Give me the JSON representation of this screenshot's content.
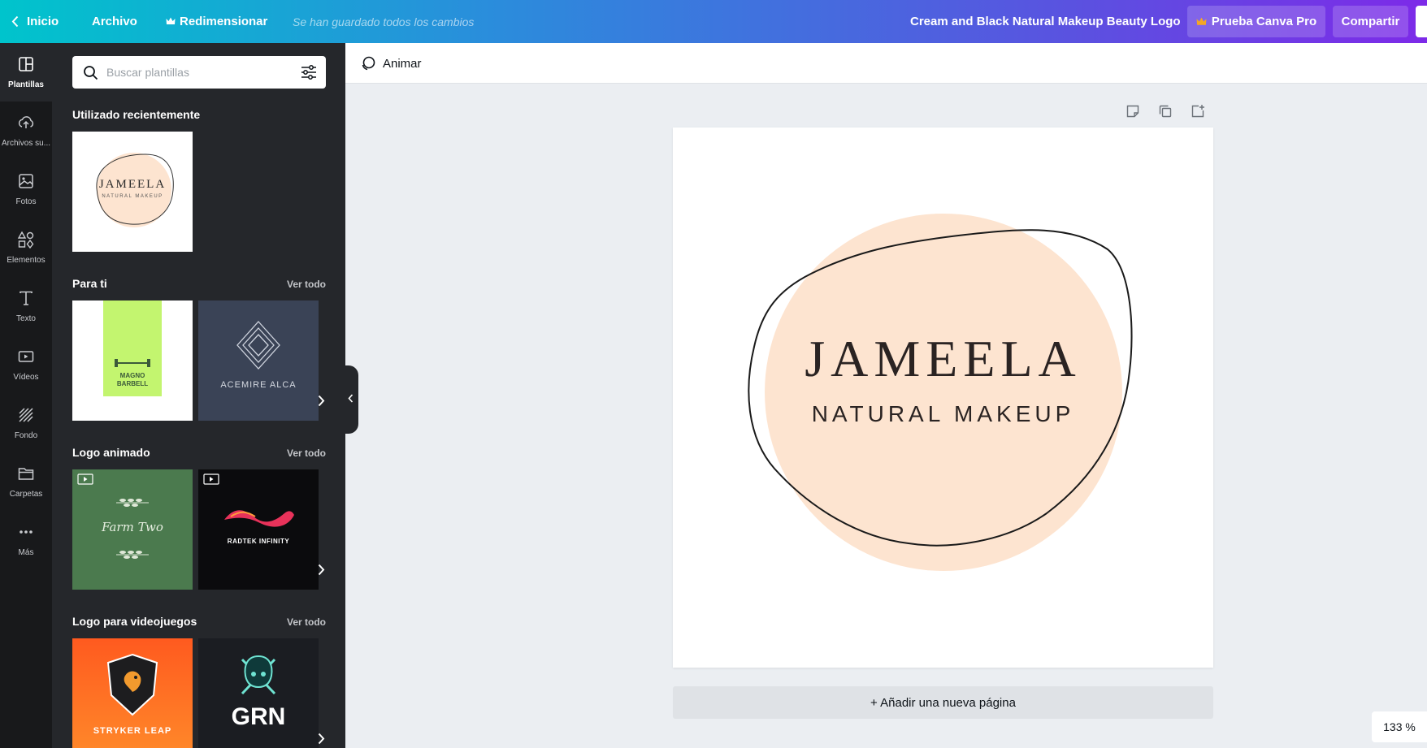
{
  "topbar": {
    "home_label": "Inicio",
    "file_label": "Archivo",
    "resize_label": "Redimensionar",
    "saved_status": "Se han guardado todos los cambios",
    "design_title": "Cream and Black Natural Makeup Beauty Logo",
    "pro_label": "Prueba Canva Pro",
    "share_label": "Compartir",
    "pro_icon": "crown-icon",
    "pro_icon_color": "#f5a623"
  },
  "rail": {
    "items": [
      {
        "label": "Plantillas",
        "icon": "templates-icon"
      },
      {
        "label": "Archivos su...",
        "icon": "upload-cloud-icon"
      },
      {
        "label": "Fotos",
        "icon": "photo-icon"
      },
      {
        "label": "Elementos",
        "icon": "shapes-icon"
      },
      {
        "label": "Texto",
        "icon": "text-icon"
      },
      {
        "label": "Vídeos",
        "icon": "video-icon"
      },
      {
        "label": "Fondo",
        "icon": "background-icon"
      },
      {
        "label": "Carpetas",
        "icon": "folder-icon"
      },
      {
        "label": "Más",
        "icon": "more-icon"
      }
    ]
  },
  "panel": {
    "search_placeholder": "Buscar plantillas",
    "recent_title": "Utilizado recientemente",
    "recent_thumb": {
      "brand": "JAMEELA",
      "tagline": "NATURAL MAKEUP"
    },
    "sections": [
      {
        "title": "Para ti",
        "link": "Ver todo",
        "thumbs": [
          {
            "text": "MAGNO BARBELL"
          },
          {
            "text": "ACEMIRE ALCA"
          }
        ]
      },
      {
        "title": "Logo animado",
        "link": "Ver todo",
        "thumbs": [
          {
            "text": "Farm Two"
          },
          {
            "text": "RADTEK INFINITY"
          }
        ]
      },
      {
        "title": "Logo para videojuegos",
        "link": "Ver todo",
        "thumbs": [
          {
            "text": "STRYKER LEAP"
          },
          {
            "text": "GRN"
          }
        ]
      }
    ]
  },
  "toolbar": {
    "animate_label": "Animar"
  },
  "canvas": {
    "brand": "JAMEELA",
    "tagline": "NATURAL MAKEUP",
    "blob_color": "#fde4d0",
    "add_page_label": "+ Añadir una nueva página",
    "zoom_label": "133 %"
  }
}
